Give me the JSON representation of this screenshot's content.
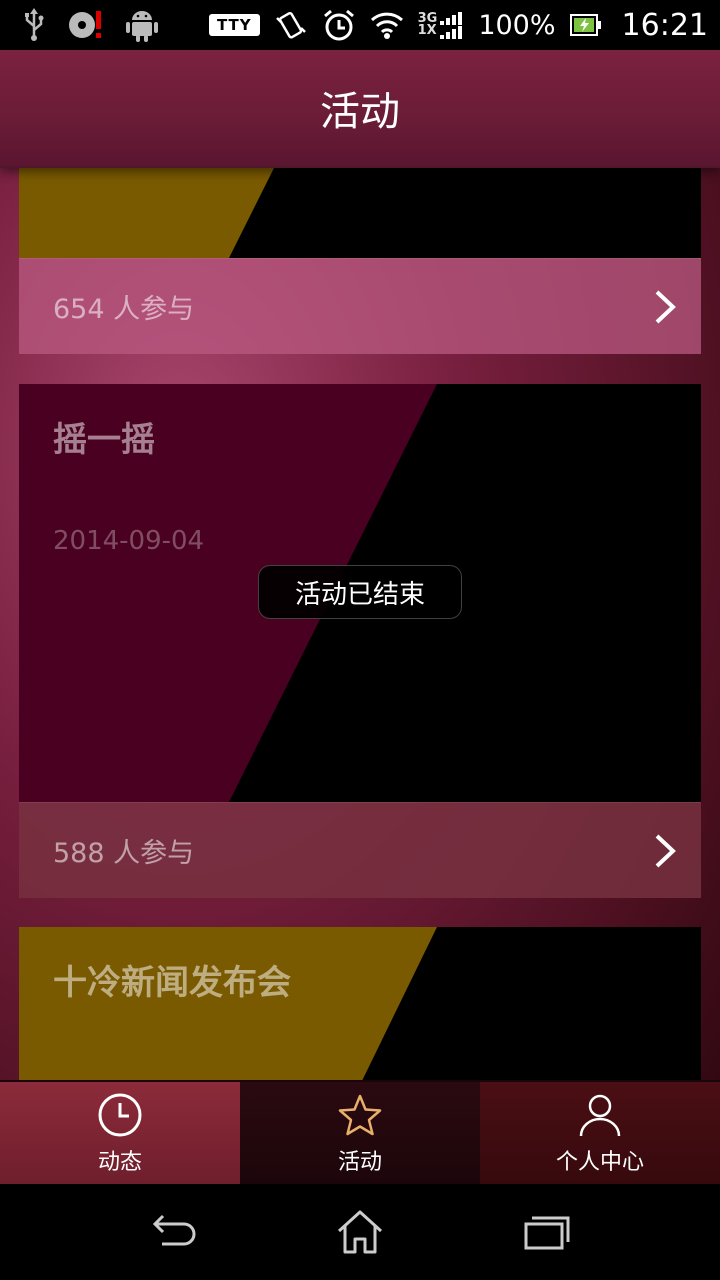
{
  "status_bar": {
    "tty_label": "TTY",
    "network_top": "3G",
    "network_bottom": "1X",
    "battery_percent": "100%",
    "time": "16:21",
    "icons": [
      "usb-icon",
      "sd-card-alert-icon",
      "android-icon",
      "vibrate-icon",
      "alarm-icon",
      "wifi-icon",
      "signal-icon",
      "battery-charging-icon"
    ]
  },
  "header": {
    "title": "活动"
  },
  "activities": [
    {
      "participants": "654 人参与",
      "media_color": "#7a5a00"
    },
    {
      "title": "摇一摇",
      "date": "2014-09-04",
      "status_badge": "活动已结束",
      "participants": "588 人参与",
      "media_color": "#4a0020"
    },
    {
      "title": "十冷新闻发布会",
      "media_color": "#7a5a00"
    }
  ],
  "tabs": [
    {
      "label": "动态",
      "icon": "clock-icon"
    },
    {
      "label": "活动",
      "icon": "star-icon",
      "selected": true
    },
    {
      "label": "个人中心",
      "icon": "person-icon"
    }
  ],
  "nav": {
    "icons": [
      "back-icon",
      "home-icon",
      "recents-icon"
    ]
  }
}
